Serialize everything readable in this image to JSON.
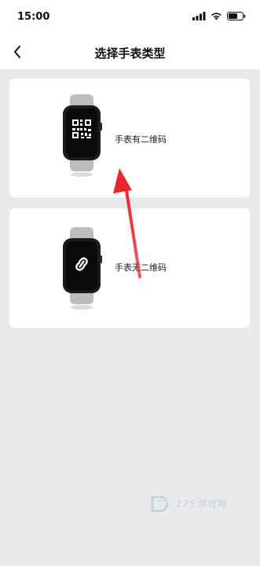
{
  "status_bar": {
    "time": "15:00",
    "icons": [
      "signal-icon",
      "wifi-icon",
      "battery-icon"
    ]
  },
  "nav": {
    "back_icon": "chevron-left-icon",
    "title": "选择手表类型"
  },
  "options": [
    {
      "label": "手表有二维码",
      "icon": "qr-code-icon"
    },
    {
      "label": "手表无二维码",
      "icon": "link-icon"
    }
  ],
  "annotation": {
    "arrow_color": "#e8272c"
  },
  "watermark": {
    "text": "175游戏网",
    "color": "#9bbfd0"
  }
}
